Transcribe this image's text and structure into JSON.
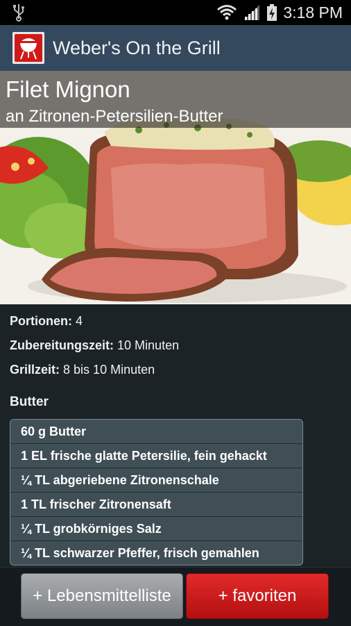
{
  "status_bar": {
    "time": "3:18 PM",
    "icons": [
      "usb-icon",
      "wifi-icon",
      "signal-icon",
      "battery-icon"
    ]
  },
  "app_bar": {
    "title": "Weber's On the Grill",
    "icon": "grill-icon"
  },
  "recipe": {
    "title": "Filet Mignon",
    "subtitle": "an Zitronen-Petersilien-Butter",
    "info": [
      {
        "label": "Portionen:",
        "value": "4"
      },
      {
        "label": "Zubereitungszeit:",
        "value": "10 Minuten"
      },
      {
        "label": "Grillzeit:",
        "value": "8 bis 10 Minuten"
      }
    ],
    "section_title": "Butter",
    "ingredients": [
      "60 g Butter",
      "1 EL frische glatte Petersilie, fein gehackt",
      "¼ TL abgeriebene Zitronenschale",
      "1 TL frischer Zitronensaft",
      "¼ TL grobkörniges Salz",
      "¼ TL schwarzer Pfeffer, frisch gemahlen"
    ]
  },
  "actions": {
    "shopping_list_label": "+ Lebensmittelliste",
    "favorites_label": "+ favoriten"
  },
  "colors": {
    "action_bar": "#34495e",
    "background": "#1b2327",
    "favorites_button": "#d01a1a",
    "list_button": "#8e9396"
  }
}
